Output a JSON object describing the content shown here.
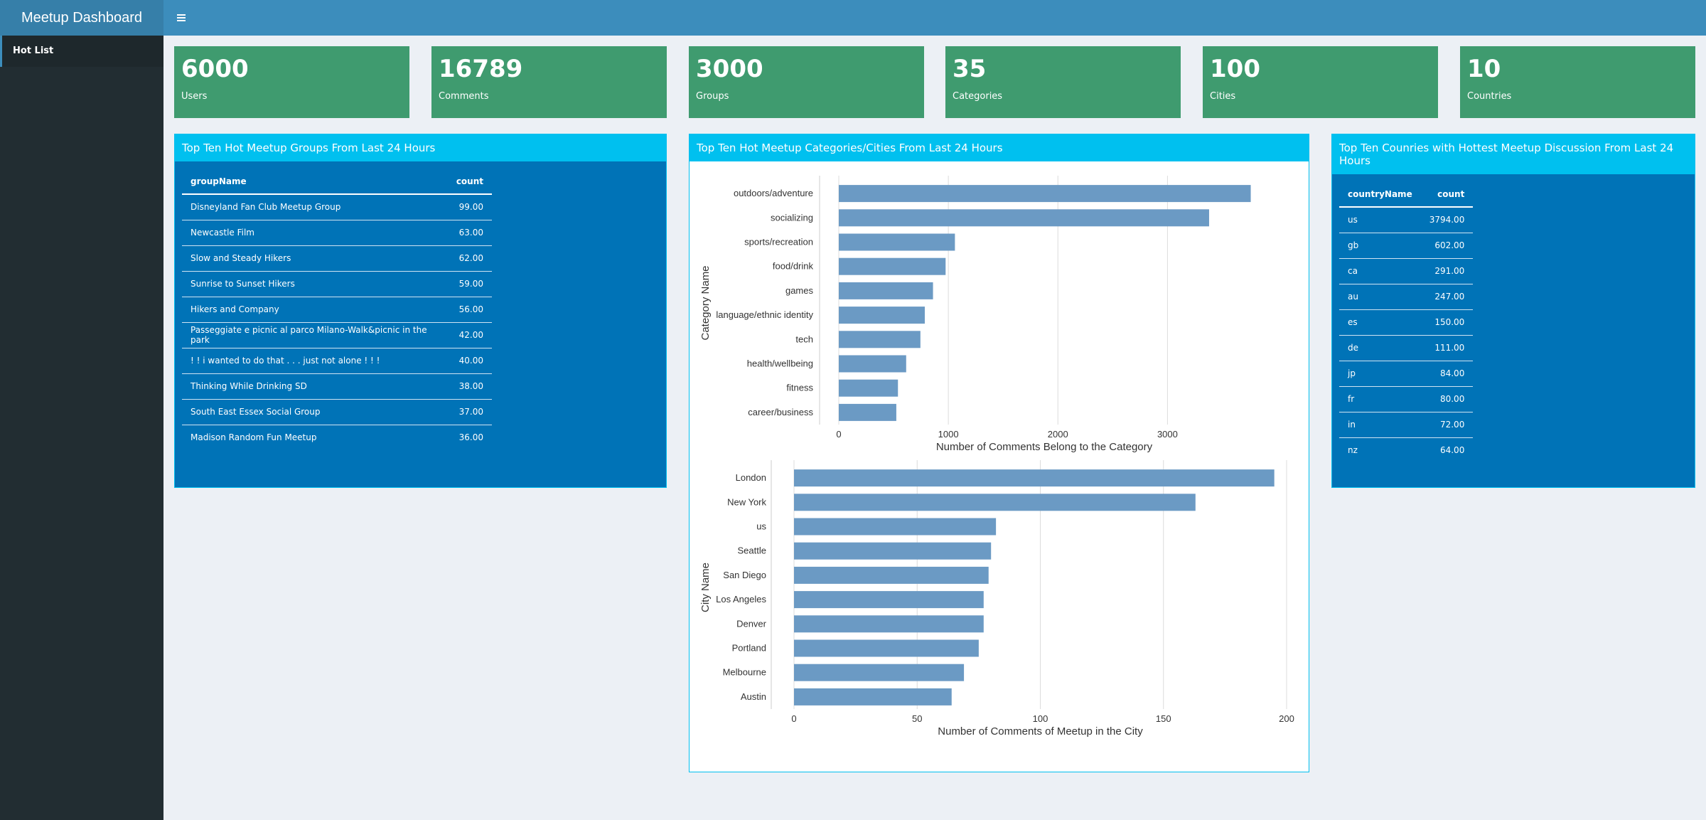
{
  "header": {
    "title": "Meetup Dashboard",
    "menu_icon": "hamburger-icon"
  },
  "sidebar": {
    "items": [
      {
        "label": "Hot List"
      }
    ]
  },
  "value_boxes": [
    {
      "value": "6000",
      "label": "Users"
    },
    {
      "value": "16789",
      "label": "Comments"
    },
    {
      "value": "3000",
      "label": "Groups"
    },
    {
      "value": "35",
      "label": "Categories"
    },
    {
      "value": "100",
      "label": "Cities"
    },
    {
      "value": "10",
      "label": "Countries"
    }
  ],
  "groups_box": {
    "title": "Top Ten Hot Meetup Groups From Last 24 Hours",
    "columns": [
      "groupName",
      "count"
    ],
    "rows": [
      [
        "Disneyland Fan Club Meetup Group",
        "99.00"
      ],
      [
        "Newcastle Film",
        "63.00"
      ],
      [
        "Slow and Steady Hikers",
        "62.00"
      ],
      [
        "Sunrise to Sunset Hikers",
        "59.00"
      ],
      [
        "Hikers and Company",
        "56.00"
      ],
      [
        "Passeggiate e picnic al parco Milano-Walk&picnic in the park",
        "42.00"
      ],
      [
        "! ! i wanted to do that . . . just not alone ! ! !",
        "40.00"
      ],
      [
        "Thinking While Drinking SD",
        "38.00"
      ],
      [
        "South East Essex Social Group",
        "37.00"
      ],
      [
        "Madison Random Fun Meetup",
        "36.00"
      ]
    ]
  },
  "charts_box": {
    "title": "Top Ten Hot Meetup Categories/Cities From Last 24 Hours"
  },
  "countries_box": {
    "title": "Top Ten Counries with Hottest Meetup Discussion From Last 24 Hours",
    "columns": [
      "countryName",
      "count"
    ],
    "rows": [
      [
        "us",
        "3794.00"
      ],
      [
        "gb",
        "602.00"
      ],
      [
        "ca",
        "291.00"
      ],
      [
        "au",
        "247.00"
      ],
      [
        "es",
        "150.00"
      ],
      [
        "de",
        "111.00"
      ],
      [
        "jp",
        "84.00"
      ],
      [
        "fr",
        "80.00"
      ],
      [
        "in",
        "72.00"
      ],
      [
        "nz",
        "64.00"
      ]
    ]
  },
  "chart_data": [
    {
      "type": "bar",
      "orientation": "horizontal",
      "categories": [
        "outdoors/adventure",
        "socializing",
        "sports/recreation",
        "food/drink",
        "games",
        "language/ethnic identity",
        "tech",
        "health/wellbeing",
        "fitness",
        "career/business"
      ],
      "values": [
        3760,
        3380,
        1060,
        975,
        860,
        785,
        745,
        615,
        540,
        525
      ],
      "xlabel": "Number of Comments Belong to the Category",
      "ylabel": "Category Name",
      "xticks": [
        0,
        1000,
        2000,
        3000
      ],
      "xlim": [
        0,
        3750
      ],
      "grid": true,
      "bar_color": "#6b9ac4"
    },
    {
      "type": "bar",
      "orientation": "horizontal",
      "categories": [
        "London",
        "New York",
        "us",
        "Seattle",
        "San Diego",
        "Los Angeles",
        "Denver",
        "Portland",
        "Melbourne",
        "Austin"
      ],
      "values": [
        195,
        163,
        82,
        80,
        79,
        77,
        77,
        75,
        69,
        64
      ],
      "xlabel": "Number of Comments of Meetup in the City",
      "ylabel": "City Name",
      "xticks": [
        0,
        50,
        100,
        150,
        200
      ],
      "xlim": [
        0,
        200
      ],
      "grid": true,
      "bar_color": "#6b9ac4"
    }
  ]
}
